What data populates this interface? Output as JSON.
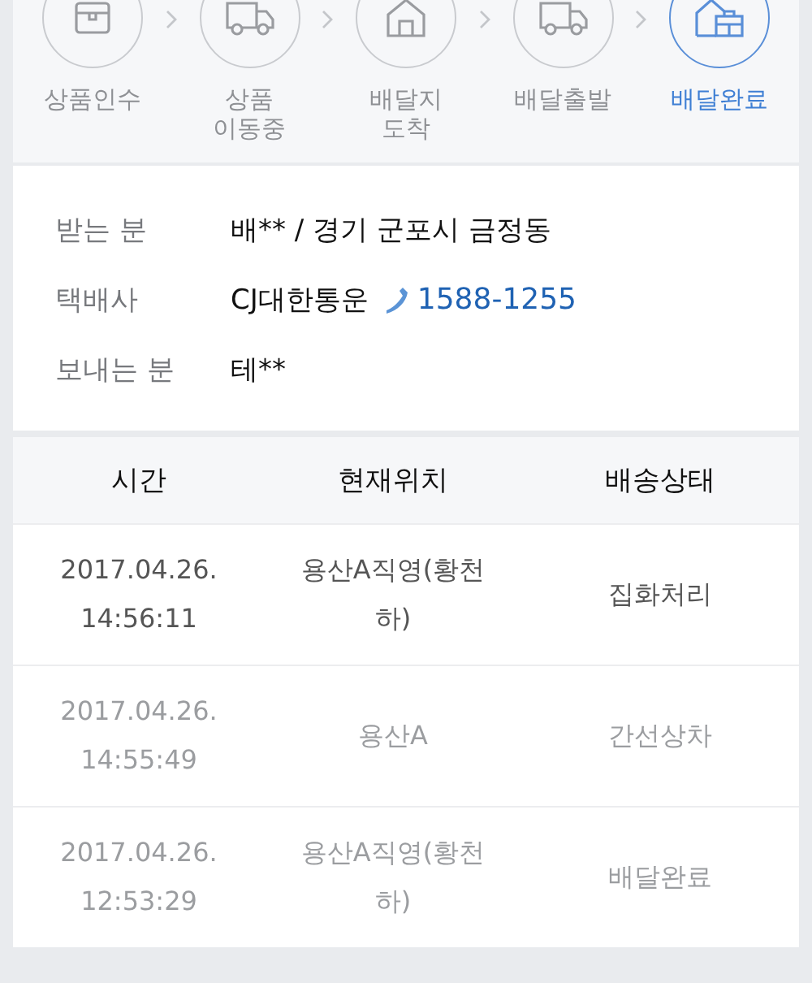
{
  "steps": [
    {
      "kind": "received",
      "label": "상품인수",
      "selected": false
    },
    {
      "kind": "moving",
      "label": "상품\n이동중",
      "selected": false
    },
    {
      "kind": "arrived",
      "label": "배달지\n도착",
      "selected": false
    },
    {
      "kind": "departed",
      "label": "배달출발",
      "selected": false
    },
    {
      "kind": "delivered",
      "label": "배달완료",
      "selected": true
    }
  ],
  "info": [
    {
      "label": "받는 분",
      "value": "배** / 경기 군포시 금정동"
    },
    {
      "label": "택배사",
      "value": "CJ대한통운",
      "phone": "1588-1255"
    },
    {
      "label": "보내는 분",
      "value": "테**"
    }
  ],
  "table": {
    "columns": [
      "시간",
      "현재위치",
      "배송상태"
    ],
    "rows": [
      {
        "time": "2017.04.26.\n14:56:11",
        "location": "용산A직영(황천\n하)",
        "status": "집화처리",
        "highlighted": true
      },
      {
        "time": "2017.04.26.\n14:55:49",
        "location": "용산A",
        "status": "간선상차",
        "highlighted": false
      },
      {
        "time": "2017.04.26.\n12:53:29",
        "location": "용산A직영(황천\n하)",
        "status": "배달완료",
        "highlighted": false
      }
    ]
  }
}
